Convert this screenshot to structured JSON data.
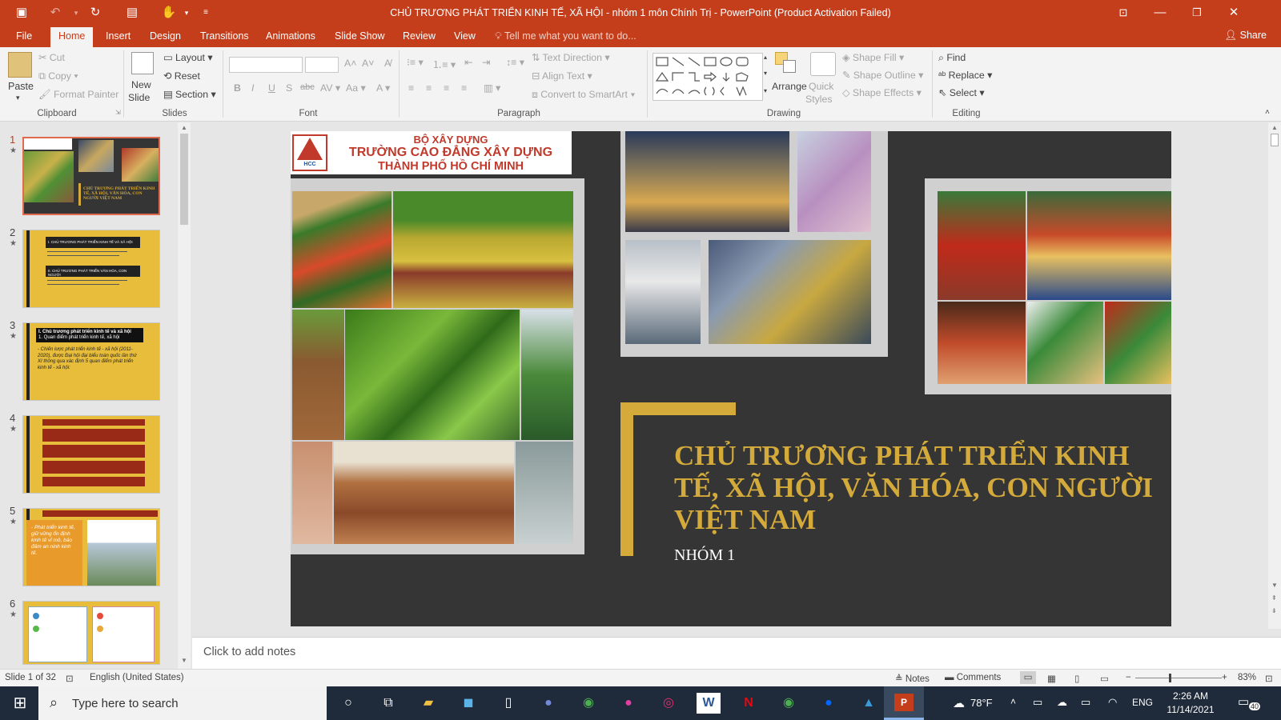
{
  "window": {
    "title": "CHỦ TRƯƠNG PHÁT TRIỂN KINH TẾ, XÃ HỘI - nhóm 1 môn Chính Trị - PowerPoint (Product Activation Failed)"
  },
  "tabs": [
    "File",
    "Home",
    "Insert",
    "Design",
    "Transitions",
    "Animations",
    "Slide Show",
    "Review",
    "View"
  ],
  "tell_me": "Tell me what you want to do...",
  "share": "Share",
  "ribbon": {
    "clipboard": {
      "paste": "Paste",
      "cut": "Cut",
      "copy": "Copy",
      "format_painter": "Format Painter",
      "label": "Clipboard"
    },
    "slides": {
      "new_slide_1": "New",
      "new_slide_2": "Slide",
      "layout": "Layout",
      "reset": "Reset",
      "section": "Section",
      "label": "Slides"
    },
    "font": {
      "label": "Font"
    },
    "paragraph": {
      "text_direction": "Text Direction",
      "align_text": "Align Text",
      "convert_smartart": "Convert to SmartArt",
      "label": "Paragraph"
    },
    "drawing": {
      "arrange": "Arrange",
      "quick_1": "Quick",
      "quick_2": "Styles",
      "shape_fill": "Shape Fill",
      "shape_outline": "Shape Outline",
      "shape_effects": "Shape Effects",
      "label": "Drawing"
    },
    "editing": {
      "find": "Find",
      "replace": "Replace",
      "select": "Select",
      "label": "Editing"
    }
  },
  "thumbnails": [
    {
      "num": "1",
      "selected": true
    },
    {
      "num": "2"
    },
    {
      "num": "3"
    },
    {
      "num": "4"
    },
    {
      "num": "5"
    },
    {
      "num": "6"
    }
  ],
  "thumb_text": {
    "t1_title": "CHỦ TRƯƠNG PHÁT TRIỂN KINH TẾ, XÃ HỘI, VĂN HÓA, CON NGƯỜI VIỆT NAM",
    "t2_h1": "I. CHỦ TRƯƠNG PHÁT TRIỂN KINH TẾ VÀ XÃ HỘI",
    "t2_h2": "II. CHỦ TRƯƠNG PHÁT TRIỂN VĂN HÓA, CON NGƯỜI",
    "t3_h": "I. Chủ trương phát triển kinh tế và xã hội",
    "t3_sub": "1. Quan điểm phát triển kinh tế, xã hội",
    "t3_body": "- Chiến lược phát triển kinh tế - xã hội (2011-2020), được Đại hội đại biểu toàn quốc lần thứ XI thông qua xác định 5 quan điểm phát triển kinh tế - xã hội:",
    "t5_side": "- Phát triển kinh tế, giữ vững ổn định kinh tế vĩ mô, bảo đảm an ninh kinh tế."
  },
  "slide": {
    "org_line1": "BỘ XÂY DỰNG",
    "org_line2": "TRƯỜNG CAO ĐẲNG XÂY DỰNG",
    "org_line3": "THÀNH PHỐ HỒ CHÍ MINH",
    "logo_text": "HCC",
    "title": "CHỦ TRƯƠNG PHÁT TRIỂN KINH TẾ, XÃ HỘI, VĂN HÓA, CON NGƯỜI VIỆT NAM",
    "subtitle": "NHÓM 1"
  },
  "notes_placeholder": "Click to add notes",
  "status": {
    "slide": "Slide 1 of 32",
    "language": "English (United States)",
    "notes": "Notes",
    "comments": "Comments",
    "zoom": "83%"
  },
  "taskbar": {
    "search": "Type here to search",
    "weather": "78°F",
    "lang": "ENG",
    "time": "2:26 AM",
    "date": "11/14/2021",
    "notif": "40"
  },
  "colors": {
    "accent": "#c43e1c",
    "slide_bg": "#353535",
    "gold": "#d4aa3a",
    "thumb_yellow": "#e8bd3c"
  }
}
